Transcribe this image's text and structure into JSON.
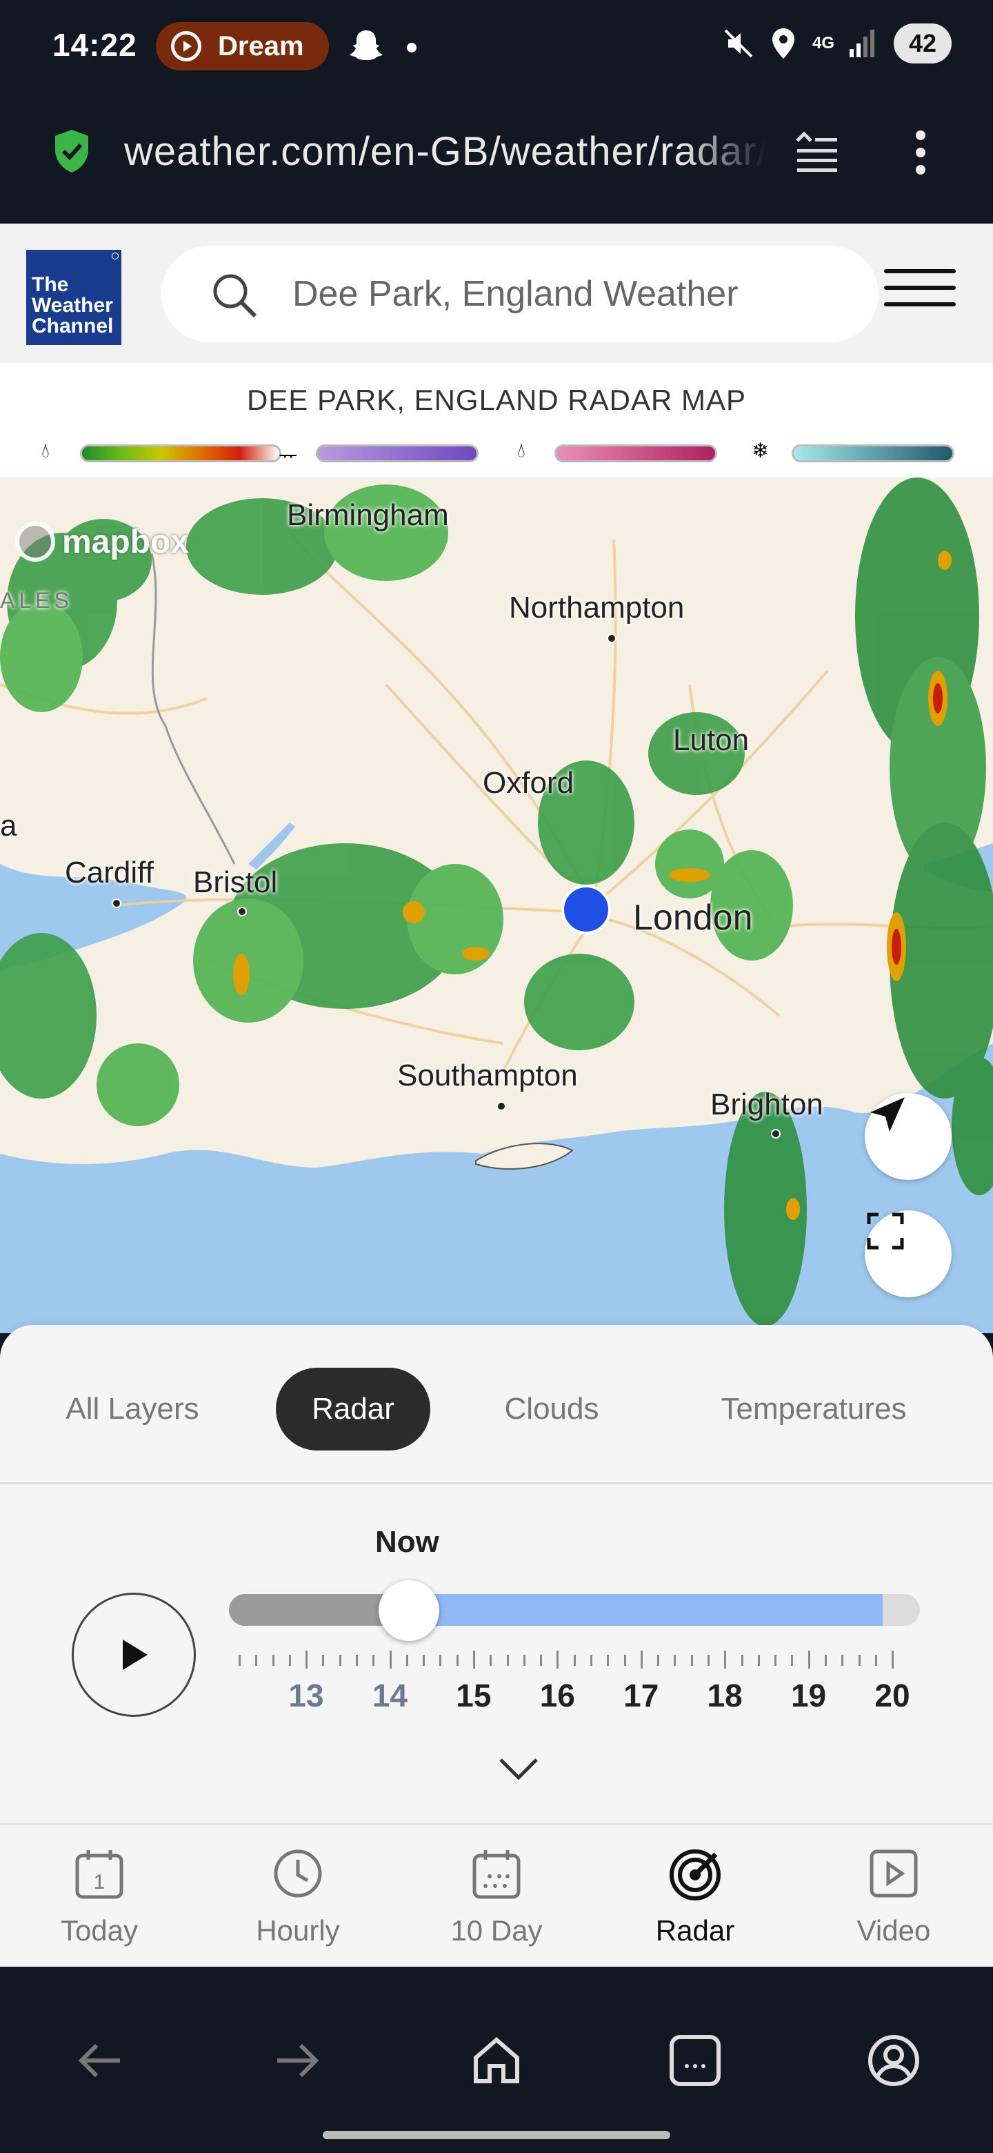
{
  "status_bar": {
    "time": "14:22",
    "notification_app": "Dream",
    "network": "4G",
    "battery": "42"
  },
  "browser": {
    "url": "weather.com/en-GB/weather/radar/interactive"
  },
  "header": {
    "logo_text": "The Weather Channel",
    "search_placeholder": "Dee Park, England Weather"
  },
  "radar": {
    "title": "DEE PARK, ENGLAND RADAR MAP",
    "legend": [
      {
        "icon": "rain-drop-icon",
        "gradient": [
          "#1f8a2a",
          "#c8c800",
          "#e03010",
          "#ffffff"
        ]
      },
      {
        "icon": "ice-icon",
        "gradient": [
          "#b89be0",
          "#6f48c0"
        ]
      },
      {
        "icon": "sleet-drop-icon",
        "gradient": [
          "#e890b8",
          "#b02060"
        ]
      },
      {
        "icon": "snowflake-icon",
        "gradient": [
          "#a8e8ec",
          "#1e5a68"
        ]
      }
    ]
  },
  "map": {
    "attribution": "mapbox",
    "cities": [
      {
        "name": "Birmingham"
      },
      {
        "name": "Northampton"
      },
      {
        "name": "Luton"
      },
      {
        "name": "Oxford"
      },
      {
        "name": "Cardiff"
      },
      {
        "name": "Bristol"
      },
      {
        "name": "London"
      },
      {
        "name": "Southampton"
      },
      {
        "name": "Brighton"
      }
    ],
    "region_labels": [
      "ALES",
      "a"
    ]
  },
  "layers": {
    "tabs": [
      "All Layers",
      "Radar",
      "Clouds",
      "Temperatures"
    ],
    "active": "Radar"
  },
  "timeline": {
    "now_label": "Now",
    "hours": [
      "13",
      "14",
      "15",
      "16",
      "17",
      "18",
      "19",
      "20"
    ],
    "past_hours": [
      "13",
      "14"
    ],
    "position_fraction": 0.26
  },
  "bottom_nav": {
    "items": [
      {
        "label": "Today",
        "icon": "calendar-day-icon"
      },
      {
        "label": "Hourly",
        "icon": "clock-icon"
      },
      {
        "label": "10 Day",
        "icon": "calendar-icon"
      },
      {
        "label": "Radar",
        "icon": "radar-icon"
      },
      {
        "label": "Video",
        "icon": "video-icon"
      }
    ],
    "today_date": "1",
    "active": "Radar"
  },
  "colors": {
    "brand": "#1a3c8f",
    "accent_blue": "#1f4fe3",
    "timeline_future": "#8fb8f4"
  }
}
